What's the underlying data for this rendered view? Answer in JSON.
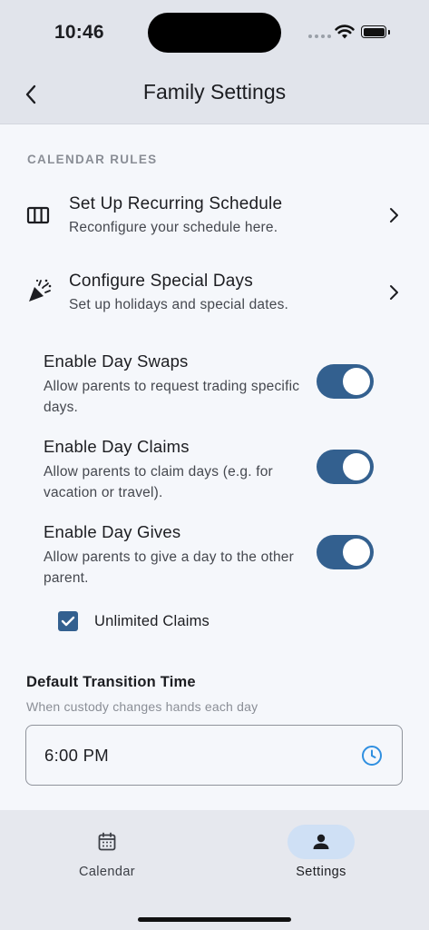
{
  "status_bar": {
    "time": "10:46"
  },
  "header": {
    "title": "Family Settings"
  },
  "section": {
    "label": "CALENDAR RULES"
  },
  "nav_rows": [
    {
      "title": "Set Up Recurring Schedule",
      "subtitle": "Reconfigure your schedule here.",
      "icon": "schedule-columns-icon"
    },
    {
      "title": "Configure Special Days",
      "subtitle": "Set up holidays and special dates.",
      "icon": "party-popper-icon"
    }
  ],
  "toggles": [
    {
      "title": "Enable Day Swaps",
      "description": "Allow parents to request trading specific days.",
      "on": true
    },
    {
      "title": "Enable Day Claims",
      "description": "Allow parents to claim days (e.g. for vacation or travel).",
      "on": true
    },
    {
      "title": "Enable Day Gives",
      "description": "Allow parents to give a day to the other parent.",
      "on": true
    }
  ],
  "checkbox": {
    "label": "Unlimited Claims",
    "checked": true
  },
  "transition": {
    "title": "Default Transition Time",
    "help": "When custody changes hands each day",
    "value": "6:00 PM"
  },
  "bottom_nav": {
    "tabs": [
      {
        "label": "Calendar",
        "icon": "calendar-icon",
        "active": false
      },
      {
        "label": "Settings",
        "icon": "person-icon",
        "active": true
      }
    ]
  },
  "colors": {
    "accent": "#33608f",
    "header_bg": "#e1e4eb",
    "page_bg": "#f5f7fb",
    "active_tab_pill": "#cfe0f5",
    "clock_icon": "#2f8fe0"
  }
}
